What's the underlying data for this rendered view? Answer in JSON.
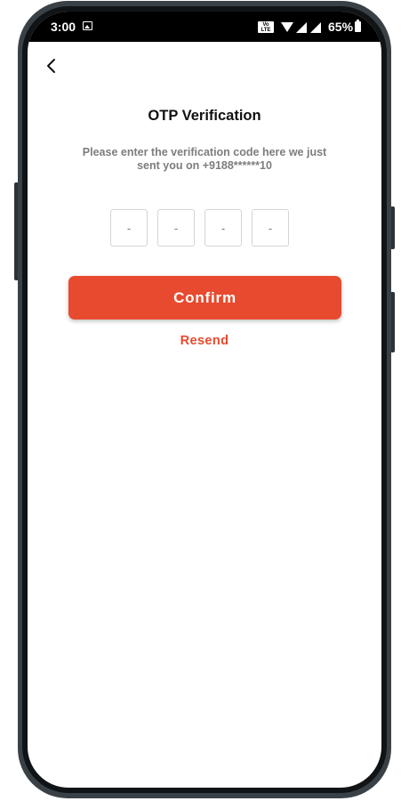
{
  "status_bar": {
    "time": "3:00",
    "volte_label": "Vo LTE",
    "battery_percent": "65%",
    "icons": [
      "image-icon",
      "volte-icon",
      "wifi-icon",
      "signal-icon",
      "signal-icon",
      "battery-icon"
    ]
  },
  "header": {
    "back_icon": "chevron-left-icon"
  },
  "main": {
    "title": "OTP Verification",
    "subtitle": "Please enter the verification code here we just sent you on +9188******10",
    "otp_fields": [
      {
        "value": "",
        "placeholder": "-"
      },
      {
        "value": "",
        "placeholder": "-"
      },
      {
        "value": "",
        "placeholder": "-"
      },
      {
        "value": "",
        "placeholder": "-"
      }
    ],
    "confirm_label": "Confirm",
    "resend_label": "Resend"
  },
  "colors": {
    "accent": "#e84a2f",
    "frame": "#3a4146",
    "status_bar": "#000000",
    "subtitle_text": "#7d7d7d"
  }
}
